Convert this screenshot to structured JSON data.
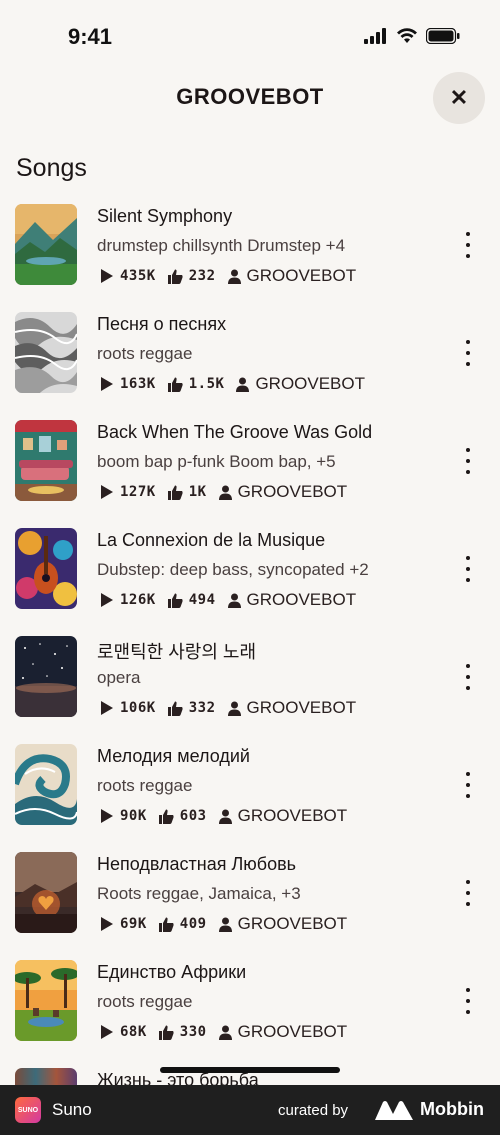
{
  "status": {
    "time": "9:41"
  },
  "header": {
    "title": "GROOVEBOT",
    "close_label": "✕"
  },
  "section_title": "Songs",
  "songs": [
    {
      "title": "Silent Symphony",
      "tags": "drumstep chillsynth Drumstep +4",
      "plays": "435K",
      "likes": "232",
      "author": "GROOVEBOT",
      "cover": "forest-lake"
    },
    {
      "title": "Песня о песнях",
      "tags": "roots reggae",
      "plays": "163K",
      "likes": "1.5K",
      "author": "GROOVEBOT",
      "cover": "grey-waves"
    },
    {
      "title": "Back When The Groove Was Gold",
      "tags": "boom bap p-funk Boom bap, +5",
      "plays": "127K",
      "likes": "1K",
      "author": "GROOVEBOT",
      "cover": "retro-living-room"
    },
    {
      "title": "La Connexion de la Musique",
      "tags": "Dubstep: deep bass, syncopated +2",
      "plays": "126K",
      "likes": "494",
      "author": "GROOVEBOT",
      "cover": "colorful-guitar"
    },
    {
      "title": "로맨틱한 사랑의 노래",
      "tags": "opera",
      "plays": "106K",
      "likes": "332",
      "author": "GROOVEBOT",
      "cover": "night-sky"
    },
    {
      "title": "Мелодия мелодий",
      "tags": "roots reggae",
      "plays": "90K",
      "likes": "603",
      "author": "GROOVEBOT",
      "cover": "ocean-wave"
    },
    {
      "title": "Неподвластная Любовь",
      "tags": "Roots reggae, Jamaica, +3",
      "plays": "69K",
      "likes": "409",
      "author": "GROOVEBOT",
      "cover": "glowing-heart"
    },
    {
      "title": "Единство Африки",
      "tags": "roots reggae",
      "plays": "68K",
      "likes": "330",
      "author": "GROOVEBOT",
      "cover": "african-savanna"
    }
  ],
  "partial_song": {
    "title": "Жизнь - это борьба"
  },
  "footer": {
    "app_name": "Suno",
    "app_icon_text": "SUNO",
    "curated_by": "curated by",
    "brand": "Mobbin"
  },
  "colors": {
    "background": "#f8f6f3",
    "text": "#1c1616",
    "close_bg": "#e8e4df",
    "footer_bg": "#1f1f1f"
  }
}
